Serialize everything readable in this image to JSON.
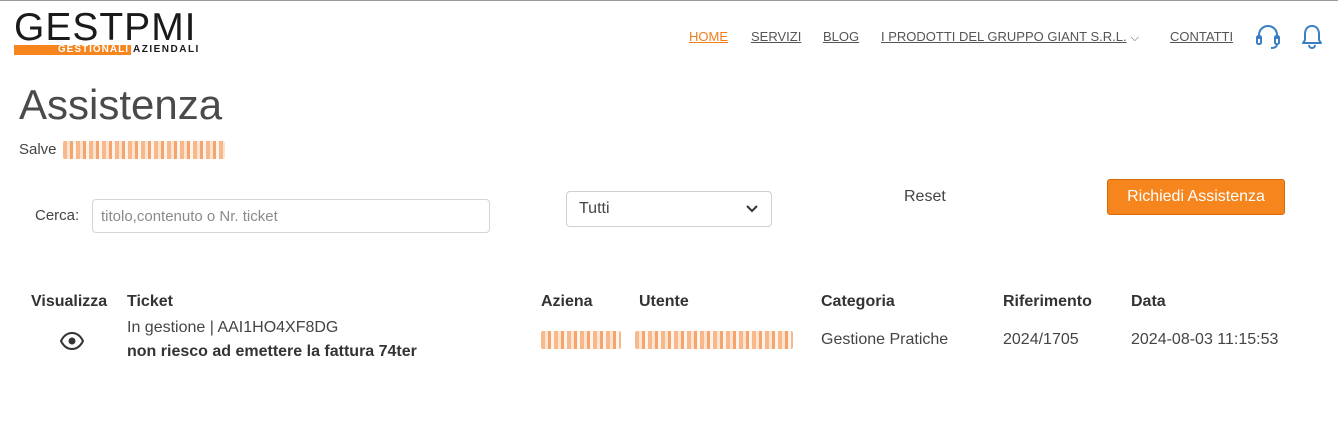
{
  "logo": {
    "main": "GESTPMI",
    "sub_highlight": "GESTIONALI",
    "sub_rest": "AZIENDALI"
  },
  "nav": {
    "items": [
      {
        "label": "HOME",
        "active": true
      },
      {
        "label": "SERVIZI"
      },
      {
        "label": "BLOG"
      },
      {
        "label": "I PRODOTTI DEL GRUPPO GIANT S.R.L.",
        "dropdown": true
      },
      {
        "label": "CONTATTI"
      }
    ],
    "icons": [
      "headset-icon",
      "bell-icon"
    ]
  },
  "page": {
    "title": "Assistenza",
    "greeting_prefix": "Salve"
  },
  "filters": {
    "search_label": "Cerca:",
    "search_placeholder": "titolo,contenuto o Nr. ticket",
    "search_value": "",
    "status_select": "Tutti",
    "reset_label": "Reset",
    "request_button": "Richiedi Assistenza"
  },
  "table": {
    "headers": [
      "Visualizza",
      "Ticket",
      "Aziena",
      "Utente",
      "Categoria",
      "Riferimento",
      "Data"
    ],
    "rows": [
      {
        "status_line": "In gestione | AAI1HO4XF8DG",
        "title": "non riesco ad emettere la fattura 74ter",
        "categoria": "Gestione Pratiche",
        "riferimento": "2024/1705",
        "data": "2024-08-03 11:15:53"
      }
    ]
  },
  "colors": {
    "accent": "#f7851e",
    "text": "#444444"
  }
}
